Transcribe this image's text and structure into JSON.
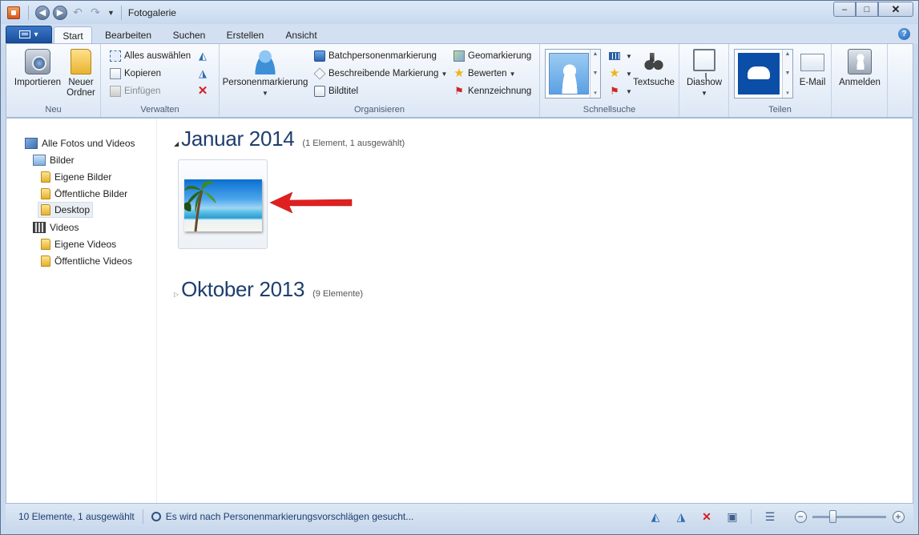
{
  "window": {
    "title": "Fotogalerie",
    "controls": {
      "minimize": "–",
      "maximize": "□",
      "close": "✕"
    }
  },
  "ribbon_tabs": [
    {
      "label": "Start",
      "active": true
    },
    {
      "label": "Bearbeiten",
      "active": false
    },
    {
      "label": "Suchen",
      "active": false
    },
    {
      "label": "Erstellen",
      "active": false
    },
    {
      "label": "Ansicht",
      "active": false
    }
  ],
  "ribbon": {
    "neu": {
      "label": "Neu",
      "importieren": "Importieren",
      "neuer_ordner_1": "Neuer",
      "neuer_ordner_2": "Ordner"
    },
    "verwalten": {
      "label": "Verwalten",
      "alles_auswaehlen": "Alles auswählen",
      "kopieren": "Kopieren",
      "einfuegen": "Einfügen"
    },
    "organisieren": {
      "label": "Organisieren",
      "personenmarkierung": "Personenmarkierung",
      "batchpersonenmarkierung": "Batchpersonenmarkierung",
      "beschreibende_markierung": "Beschreibende Markierung",
      "bildtitel": "Bildtitel",
      "geomarkierung": "Geomarkierung",
      "bewerten": "Bewerten",
      "kennzeichnung": "Kennzeichnung"
    },
    "schnellsuche": {
      "label": "Schnellsuche",
      "textsuche": "Textsuche"
    },
    "diashow": "Diashow",
    "teilen": {
      "label": "Teilen",
      "email": "E-Mail"
    },
    "anmelden": "Anmelden"
  },
  "navigation": {
    "items": [
      {
        "label": "Alle Fotos und Videos",
        "icon": "photos-icon"
      },
      {
        "label": "Bilder",
        "icon": "pictures-icon"
      },
      {
        "label": "Eigene Bilder",
        "icon": "folder-icon"
      },
      {
        "label": "Öffentliche Bilder",
        "icon": "folder-icon"
      },
      {
        "label": "Desktop",
        "icon": "folder-icon",
        "selected": true
      },
      {
        "label": "Videos",
        "icon": "video-icon"
      },
      {
        "label": "Eigene Videos",
        "icon": "folder-icon"
      },
      {
        "label": "Öffentliche Videos",
        "icon": "folder-icon"
      }
    ]
  },
  "gallery": {
    "groups": [
      {
        "title": "Januar 2014",
        "count": "(1 Element, 1 ausgewählt)",
        "expanded": true
      },
      {
        "title": "Oktober 2013",
        "count": "(9 Elemente)",
        "expanded": false
      }
    ]
  },
  "status": {
    "count": "10 Elemente, 1 ausgewählt",
    "message": "Es wird nach Personenmarkierungsvorschlägen gesucht...",
    "zoom_level": 0.27
  },
  "colors": {
    "accent": "#1a4f9d",
    "title_text": "#1e3e6e",
    "arrow": "#e02020"
  }
}
